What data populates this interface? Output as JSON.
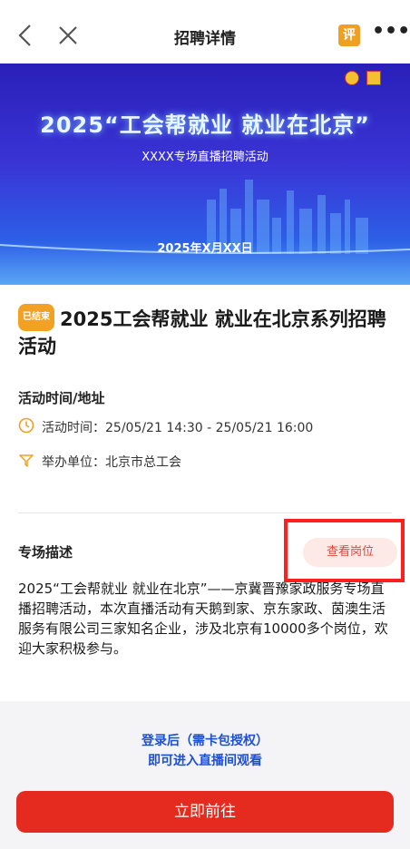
{
  "nav": {
    "title": "招聘详情",
    "eval_label": "评",
    "more_label": "•••"
  },
  "banner": {
    "title": "2025“工会帮就业 就业在北京”",
    "subtitle": "XXXX专场直播招聘活动",
    "date": "2025年X月XX日"
  },
  "event": {
    "status": "已结束",
    "title": "2025工会帮就业 就业在北京系列招聘活动"
  },
  "details": {
    "section_label": "活动时间/地址",
    "time": "活动时间：25/05/21 14:30 - 25/05/21 16:00",
    "organizer": "举办单位：北京市总工会"
  },
  "description": {
    "section_label": "专场描述",
    "view_jobs_label": "查看岗位",
    "text": "2025“工会帮就业 就业在北京”——京冀晋豫家政服务专场直播招聘活动，本次直播活动有天鹅到家、京东家政、茵澳生活服务有限公司三家知名企业，涉及北京有10000多个岗位，欢迎大家积极参与。"
  },
  "footer": {
    "login_line1": "登录后（需卡包授权）",
    "login_line2": "即可进入直播间观看",
    "cta_label": "立即前往"
  },
  "colors": {
    "accent_red": "#e52b1f",
    "badge_orange": "#f3a124",
    "link_blue": "#1d4fd6"
  }
}
